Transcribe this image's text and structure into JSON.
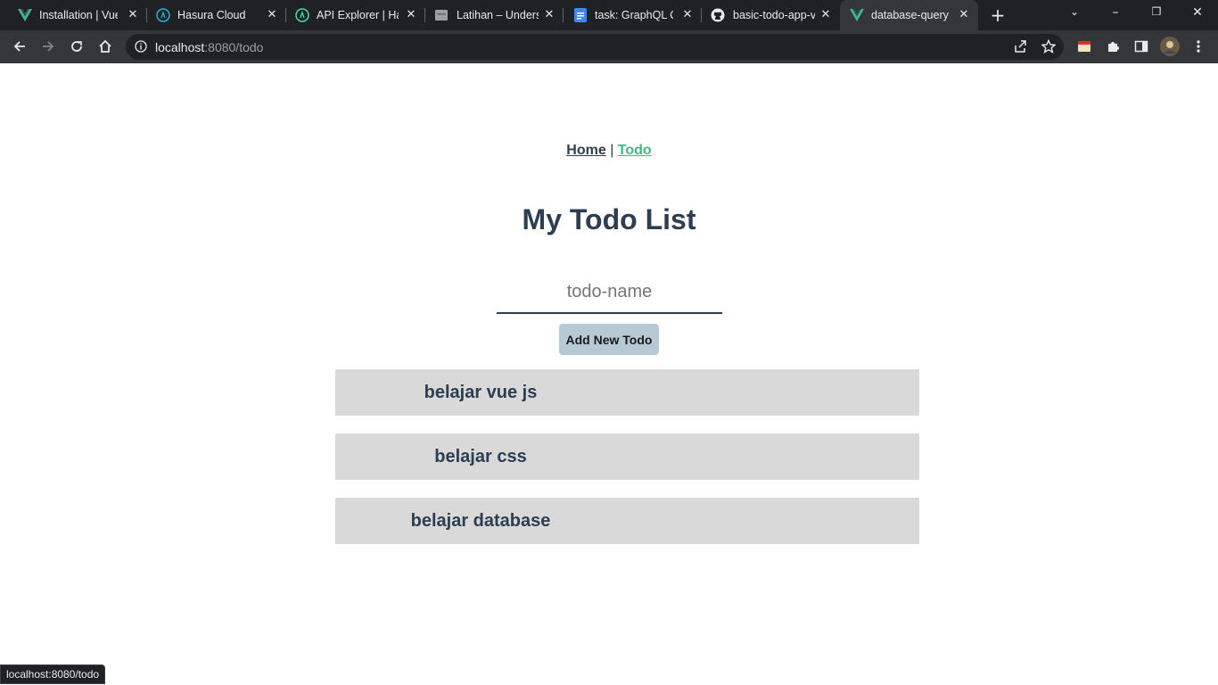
{
  "browser": {
    "tabs": [
      {
        "title": "Installation | Vue",
        "icon": "vue-logo-icon"
      },
      {
        "title": "Hasura Cloud",
        "icon": "hasura-logo-icon"
      },
      {
        "title": "API Explorer | Ha",
        "icon": "hasura-logo-icon"
      },
      {
        "title": "Latihan – Unders",
        "icon": "page-icon"
      },
      {
        "title": "task: GraphQL Q",
        "icon": "docs-icon"
      },
      {
        "title": "basic-todo-app-v",
        "icon": "github-icon"
      },
      {
        "title": "database-query",
        "icon": "vue-logo-icon",
        "active": true
      }
    ],
    "url_host": "localhost",
    "url_rest": ":8080/todo",
    "status_text": "localhost:8080/todo"
  },
  "nav": {
    "home": "Home",
    "separator": "|",
    "todo": "Todo"
  },
  "page": {
    "title": "My Todo List",
    "input_placeholder": "todo-name",
    "input_value": "",
    "add_button": "Add New Todo"
  },
  "todos": [
    "belajar vue js",
    "belajar css",
    "belajar database"
  ],
  "colors": {
    "accent": "#42b983",
    "text": "#2c3e50",
    "item_bg": "#d9d9d9",
    "button_bg": "#b8c9d6"
  }
}
